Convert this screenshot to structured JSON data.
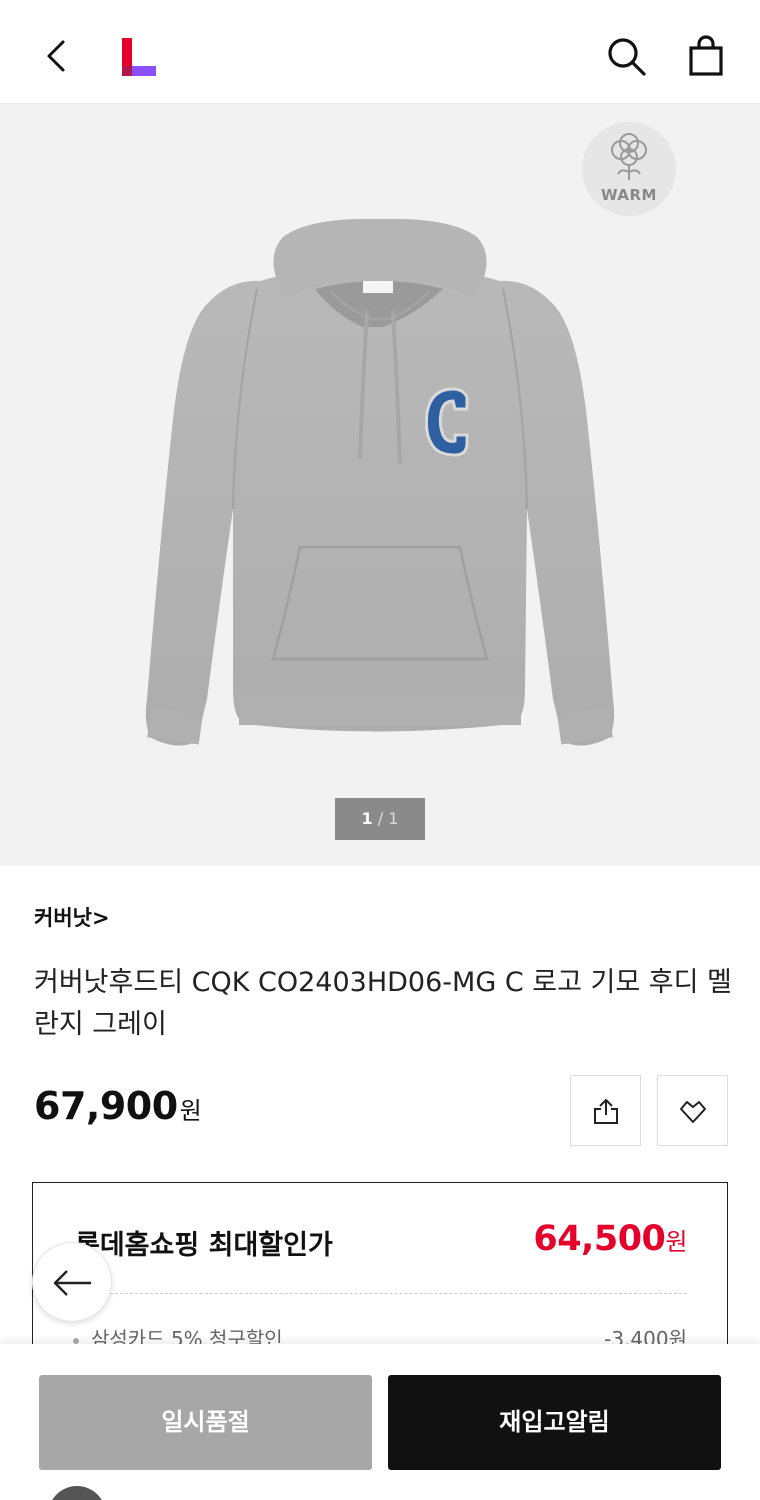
{
  "header": {
    "back_icon": "chevron-left-icon",
    "logo_icon": "lotte-logo",
    "search_icon": "search-icon",
    "cart_icon": "shopping-bag-icon"
  },
  "gallery": {
    "badge_label": "WARM",
    "badge_icon": "cotton-icon",
    "current_page": "1",
    "separator": "/",
    "total_pages": "1"
  },
  "product": {
    "brand": "커버낫",
    "brand_arrow": ">",
    "title": "커버낫후드티 CQK CO2403HD06-MG C 로고 기모 후디 멜란지 그레이",
    "price": "67,900",
    "price_unit": "원"
  },
  "discount": {
    "label": "롯데홈쇼핑 최대할인가",
    "price": "64,500",
    "price_unit": "원",
    "card_text": "삼성카드 5% 청구할인",
    "card_amount": "-3,400원"
  },
  "actions": {
    "soldout_label": "일시품절",
    "notify_label": "재입고알림"
  },
  "colors": {
    "accent_red": "#e4002b",
    "logo_red": "#e4002b",
    "logo_purple": "#8a4fff",
    "soldout_gray": "#a7a7a7",
    "notify_black": "#111111"
  }
}
